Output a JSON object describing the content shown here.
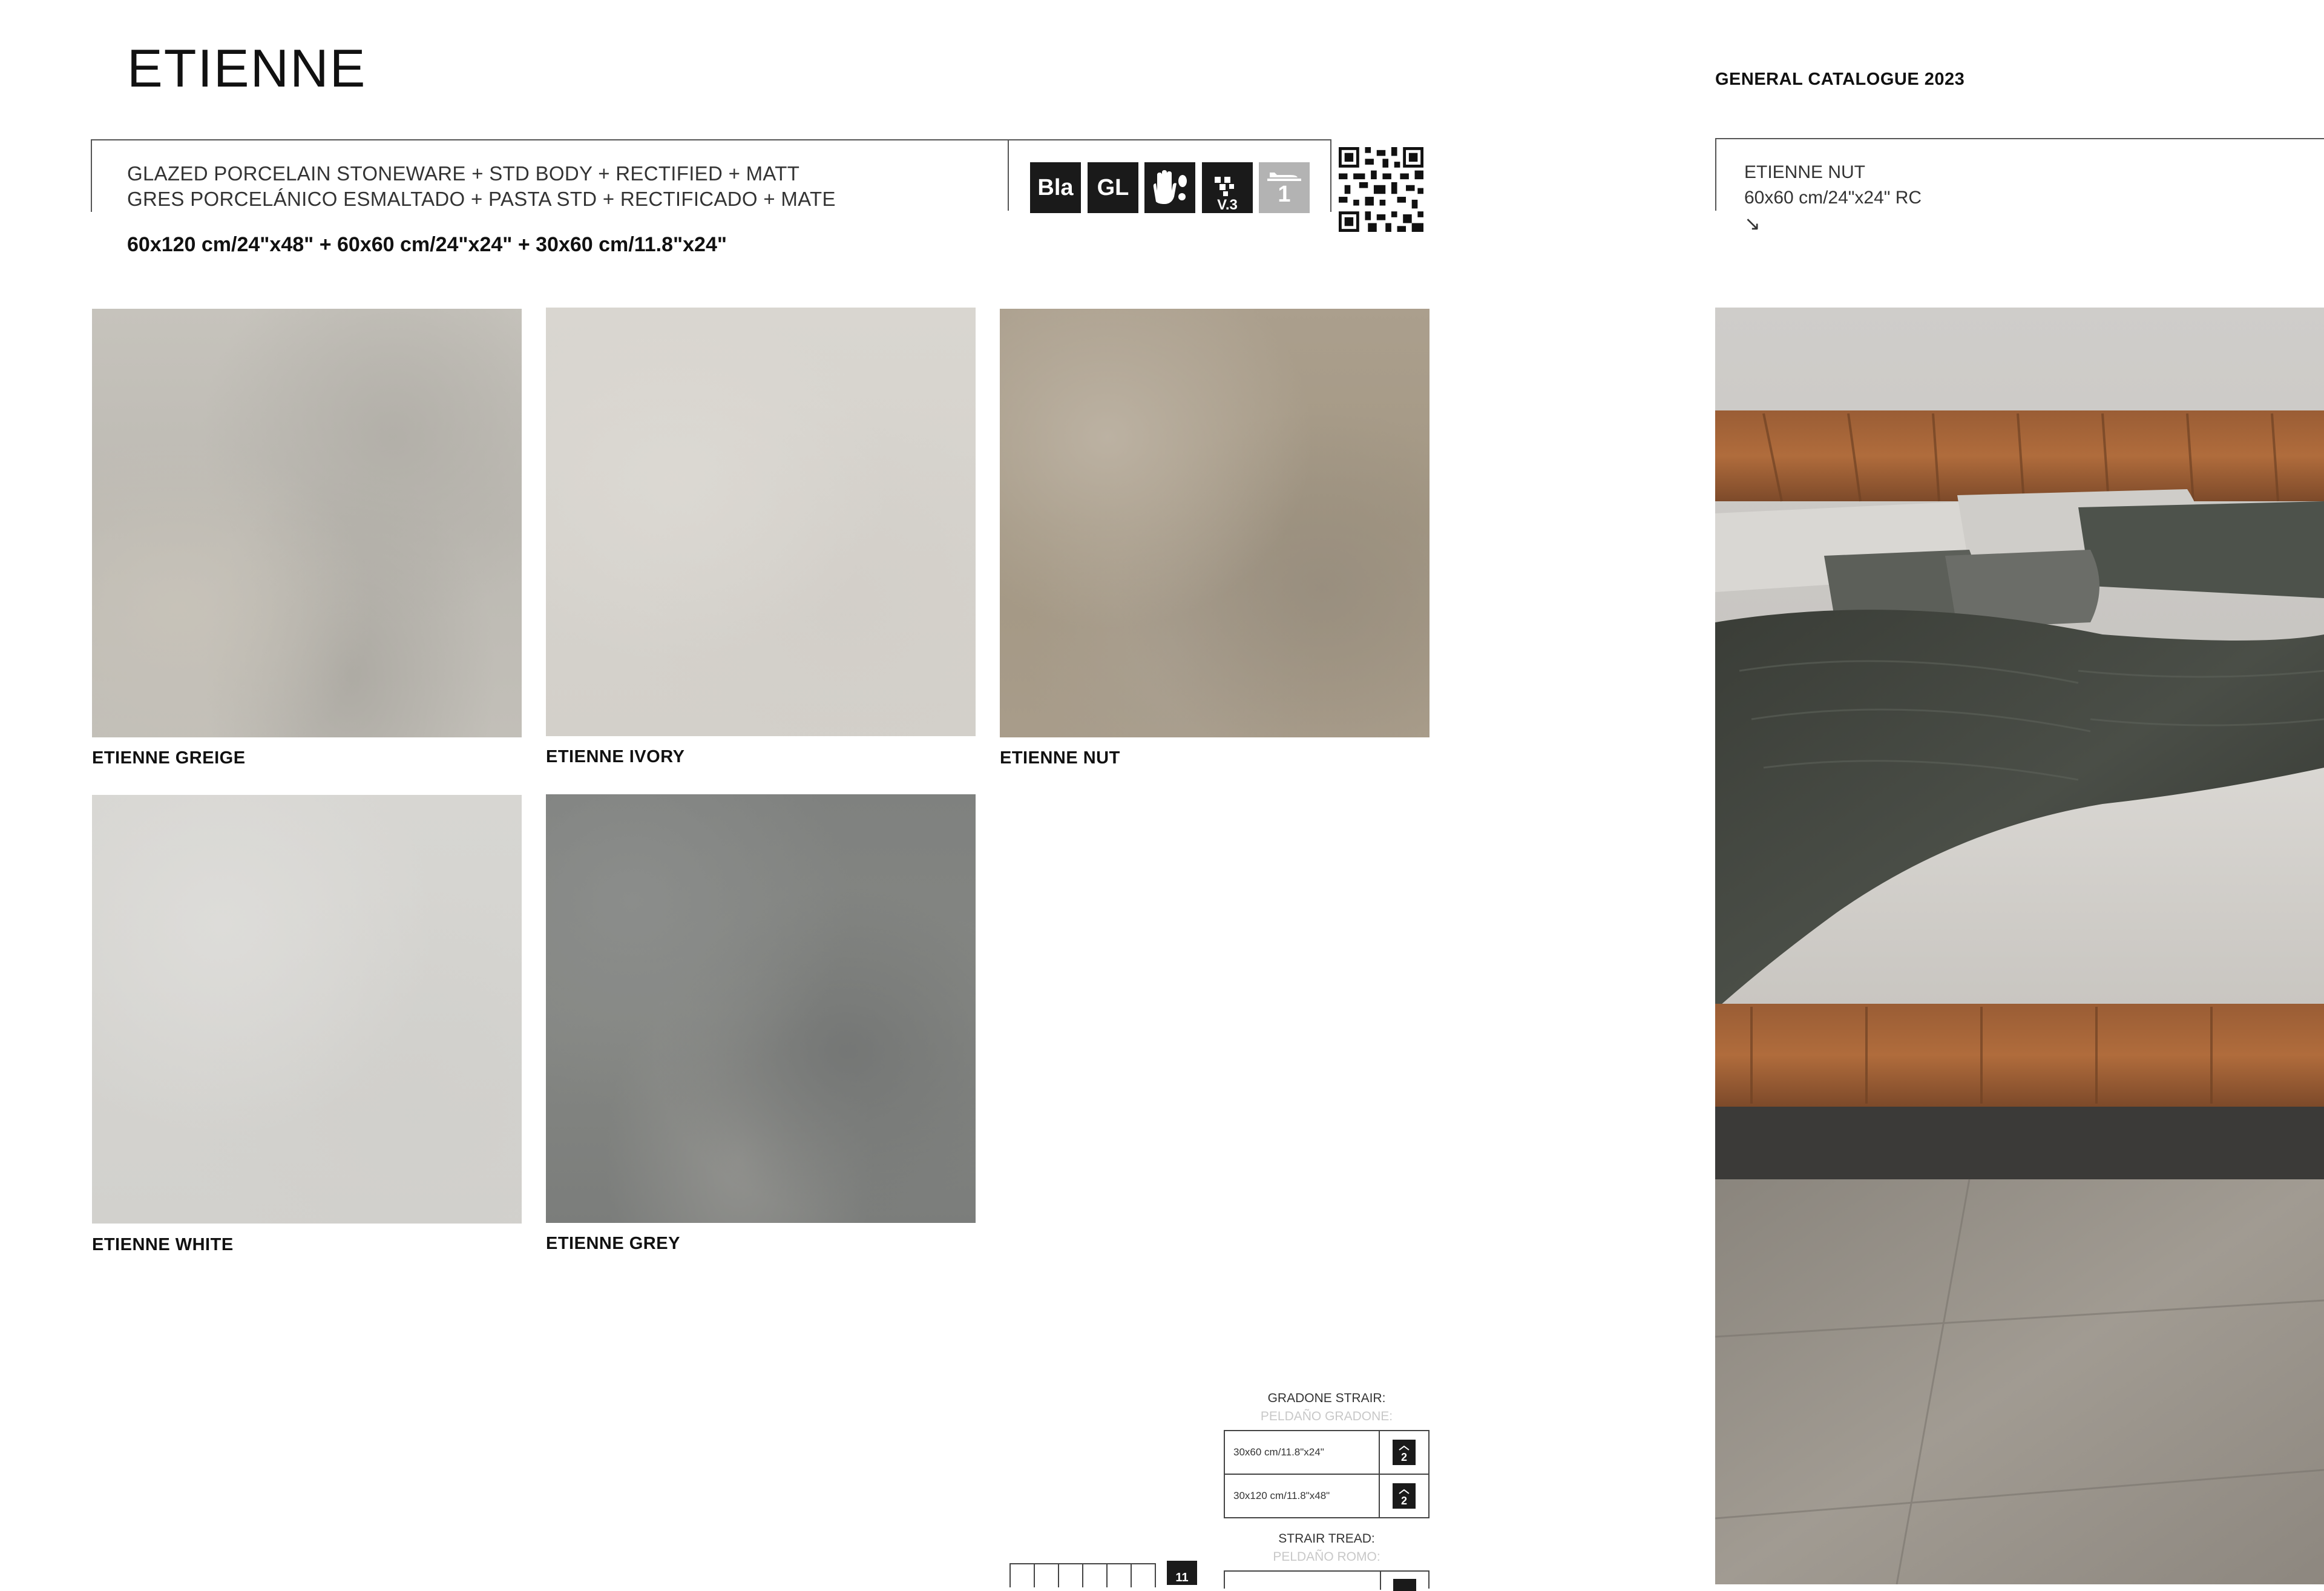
{
  "header": {
    "title": "ETIENNE",
    "spec_en": "GLAZED PORCELAIN STONEWARE + STD BODY + RECTIFIED + MATT",
    "spec_es": "GRES PORCELÁNICO ESMALTADO + PASTA STD + RECTIFICADO + MATE",
    "sizes": "60x120 cm/24\"x48\" + 60x60 cm/24\"x24\" + 30x60 cm/11.8\"x24\""
  },
  "badges": {
    "bla": "Bla",
    "gl": "GL",
    "variation": "V.3",
    "slip": "1"
  },
  "swatches": [
    {
      "label": "ETIENNE GREIGE"
    },
    {
      "label": "ETIENNE IVORY"
    },
    {
      "label": "ETIENNE NUT"
    },
    {
      "label": "ETIENNE WHITE"
    },
    {
      "label": "ETIENNE GREY"
    }
  ],
  "steps": {
    "gradone_title": "GRADONE STRAIR:",
    "gradone_sub": "PELDAÑO GRADONE:",
    "gradone_rows": [
      {
        "size": "30x60 cm/11.8\"x24\"",
        "count": "2"
      },
      {
        "size": "30x120 cm/11.8\"x48\"",
        "count": "2"
      }
    ],
    "tread_title": "STRAIR TREAD:",
    "tread_sub": "PELDAÑO ROMO:",
    "pack_count": "11"
  },
  "right_page": {
    "catalogue": "GENERAL CATALOGUE 2023",
    "product": "ETIENNE NUT",
    "product_size": "60x60 cm/24\"x24\" RC",
    "arrow": "↘"
  },
  "colors": {
    "badge_dark": "#1a1a1a",
    "badge_grey": "#b3b3b3"
  }
}
